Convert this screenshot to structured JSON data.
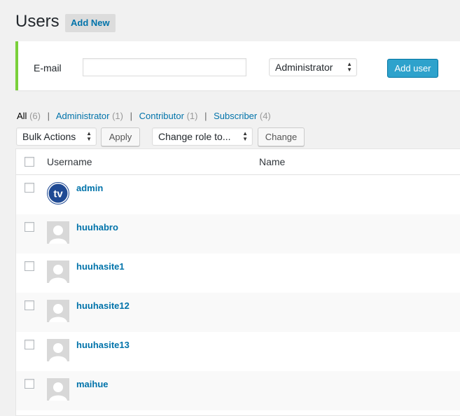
{
  "header": {
    "title": "Users",
    "add_new_label": "Add New"
  },
  "add_form": {
    "email_label": "E-mail",
    "email_value": "",
    "role_selected": "Administrator",
    "submit_label": "Add user"
  },
  "views": {
    "all": {
      "label": "All",
      "count": "(6)"
    },
    "administrator": {
      "label": "Administrator",
      "count": "(1)"
    },
    "contributor": {
      "label": "Contributor",
      "count": "(1)"
    },
    "subscriber": {
      "label": "Subscriber",
      "count": "(4)"
    },
    "separator": "|"
  },
  "tablenav": {
    "bulk_actions": "Bulk Actions",
    "apply_label": "Apply",
    "change_role": "Change role to...",
    "change_label": "Change"
  },
  "table": {
    "columns": {
      "username": "Username",
      "name": "Name"
    },
    "rows": [
      {
        "username": "admin",
        "avatar": "tv-logo-avatar"
      },
      {
        "username": "huuhabro",
        "avatar": "default-avatar"
      },
      {
        "username": "huuhasite1",
        "avatar": "default-avatar"
      },
      {
        "username": "huuhasite12",
        "avatar": "default-avatar"
      },
      {
        "username": "huuhasite13",
        "avatar": "default-avatar"
      },
      {
        "username": "maihue",
        "avatar": "default-avatar"
      }
    ]
  },
  "colors": {
    "accent_border": "#7ad03a",
    "primary_button": "#2ea2cc",
    "link": "#0073aa",
    "avatar_logo": "#1f4a94"
  },
  "icons": {
    "select_arrows": "updown-arrows-icon",
    "logo_text": "tv"
  }
}
